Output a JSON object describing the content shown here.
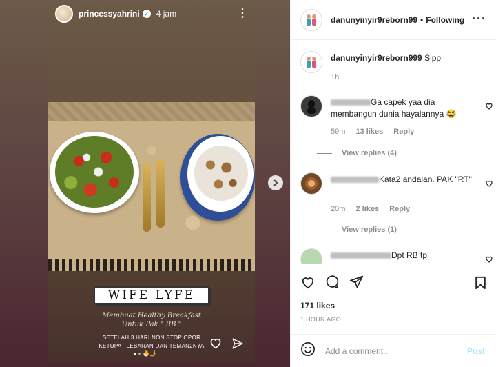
{
  "story": {
    "username": "princessyahrini",
    "time": "4 jam",
    "banner": "WIFE LYFE",
    "caption_line1": "Membuat Healthy Breakfast",
    "caption_line2": "Untuk Pak \" RB \"",
    "note_line1": "SETELAH 3 HARI NON STOP OPOR",
    "note_line2": "KETUPAT LEBARAN DAN TEMAN2NYA"
  },
  "post": {
    "username": "danunyinyir9reborn99",
    "separator": "•",
    "follow_label": "Following",
    "likes": "171 likes",
    "time_ago": "1 HOUR AGO",
    "add_comment_placeholder": "Add a comment...",
    "post_label": "Post"
  },
  "caption": {
    "username": "danunyinyir9reborn999",
    "text": "Sipp",
    "time": "1h"
  },
  "comments": [
    {
      "text": "Ga capek yaa dia membangun dunia hayalannya 😂",
      "time": "59m",
      "likes": "13 likes",
      "reply_label": "Reply",
      "view_replies": "View replies (4)"
    },
    {
      "text": "Kata2 andalan. PAK \"RT\"",
      "time": "20m",
      "likes": "2 likes",
      "reply_label": "Reply",
      "view_replies": "View replies (1)"
    },
    {
      "text": "Dpt RB tp"
    }
  ],
  "icons": {
    "more": "more-options-icon",
    "heart": "heart-icon",
    "comment": "comment-icon",
    "share": "send-icon",
    "bookmark": "bookmark-icon",
    "emoji": "emoji-icon",
    "next": "chevron-right-icon"
  }
}
